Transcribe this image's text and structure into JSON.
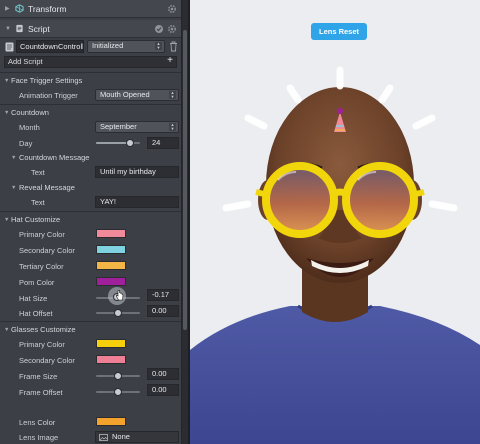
{
  "inspector": {
    "transform": {
      "title": "Transform"
    },
    "script": {
      "title": "Script",
      "name": "CountdownController",
      "state": "Initialized",
      "add_label": "Add Script"
    },
    "face_trigger": {
      "title": "Face Trigger Settings",
      "animation_trigger_label": "Animation Trigger",
      "animation_trigger_value": "Mouth Opened"
    },
    "countdown": {
      "title": "Countdown",
      "month_label": "Month",
      "month_value": "September",
      "day_label": "Day",
      "day_value": "24",
      "day_slider_fraction": 0.78,
      "message_title": "Countdown Message",
      "message_text_label": "Text",
      "message_text_value": "Until my birthday",
      "reveal_title": "Reveal Message",
      "reveal_text_label": "Text",
      "reveal_text_value": "YAY!"
    },
    "hat": {
      "title": "Hat Customize",
      "primary_label": "Primary Color",
      "primary_color": "#f08a9b",
      "secondary_label": "Secondary Color",
      "secondary_color": "#7fd3e0",
      "tertiary_label": "Tertiary Color",
      "tertiary_color": "#f3b646",
      "pom_label": "Pom Color",
      "pom_color": "#a01f9a",
      "size_label": "Hat Size",
      "size_value": "-0.17",
      "offset_label": "Hat Offset",
      "offset_value": "0.00"
    },
    "glasses": {
      "title": "Glasses Customize",
      "primary_label": "Primary Color",
      "primary_color": "#f6d10b",
      "secondary_label": "Secondary Color",
      "secondary_color": "#ef7f94",
      "frame_size_label": "Frame Size",
      "frame_size_value": "0.00",
      "frame_offset_label": "Frame Offset",
      "frame_offset_value": "0.00",
      "lens_color_label": "Lens Color",
      "lens_color": "#f3a32c",
      "lens_image_label": "Lens Image",
      "lens_image_value": "None"
    }
  },
  "preview": {
    "lens_reset_label": "Lens Reset",
    "glasses_color": "#f2d60c"
  }
}
